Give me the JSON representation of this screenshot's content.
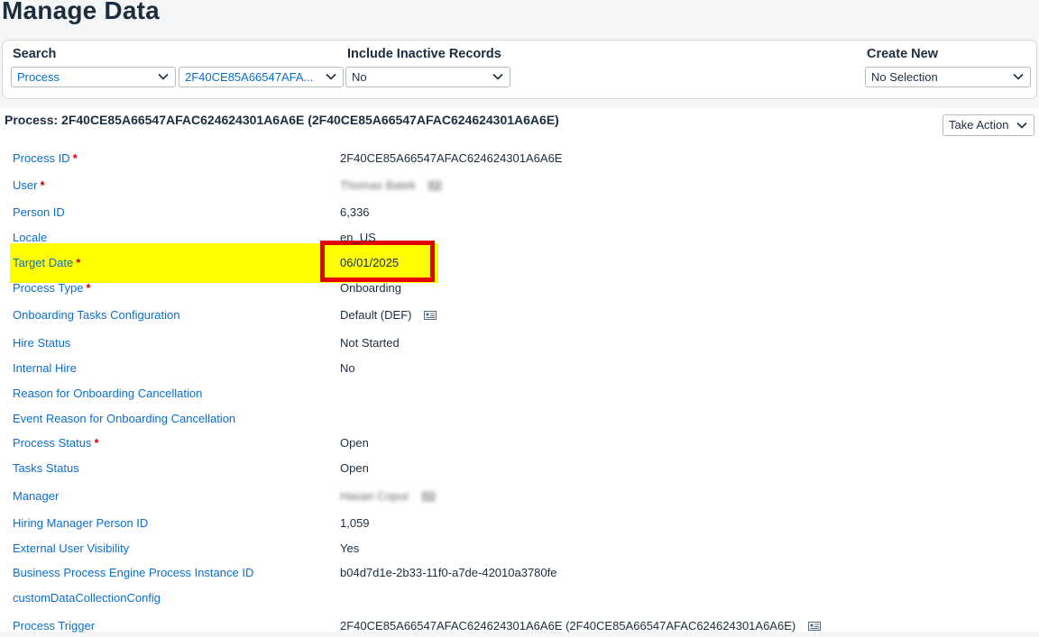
{
  "page": {
    "title": "Manage Data"
  },
  "filter_bar": {
    "search_label": "Search",
    "search_type_value": "Process",
    "search_record_value": "2F40CE85A66547AFA...",
    "inactive_label": "Include Inactive Records",
    "inactive_value": "No",
    "create_label": "Create New",
    "create_value": "No Selection"
  },
  "record": {
    "title": "Process: 2F40CE85A66547AFAC624624301A6A6E (2F40CE85A66547AFAC624624301A6A6E)",
    "take_action_label": "Take Action"
  },
  "fields": [
    {
      "label": "Process ID",
      "required": "*",
      "value": "2F40CE85A66547AFAC624624301A6A6E"
    },
    {
      "label": "User",
      "required": "*",
      "value": "Thomas Batek"
    },
    {
      "label": "Person ID",
      "required": "",
      "value": "6,336"
    },
    {
      "label": "Locale",
      "required": "",
      "value": "en_US"
    },
    {
      "label": "Target Date",
      "required": "*",
      "value": "06/01/2025"
    },
    {
      "label": "Process Type",
      "required": "*",
      "value": "Onboarding"
    },
    {
      "label": "Onboarding Tasks Configuration",
      "required": "",
      "value": "Default (DEF)"
    },
    {
      "label": "Hire Status",
      "required": "",
      "value": "Not Started"
    },
    {
      "label": "Internal Hire",
      "required": "",
      "value": "No"
    },
    {
      "label": "Reason for Onboarding Cancellation",
      "required": "",
      "value": ""
    },
    {
      "label": "Event Reason for Onboarding Cancellation",
      "required": "",
      "value": ""
    },
    {
      "label": "Process Status",
      "required": "*",
      "value": "Open"
    },
    {
      "label": "Tasks Status",
      "required": "",
      "value": "Open"
    },
    {
      "label": "Manager",
      "required": "",
      "value": "Hasan Copur"
    },
    {
      "label": "Hiring Manager Person ID",
      "required": "",
      "value": "1,059"
    },
    {
      "label": "External User Visibility",
      "required": "",
      "value": "Yes"
    },
    {
      "label": "Business Process Engine Process Instance ID",
      "required": "",
      "value": "b04d7d1e-2b33-11f0-a7de-42010a3780fe"
    },
    {
      "label": "customDataCollectionConfig",
      "required": "",
      "value": ""
    },
    {
      "label": "Process Trigger",
      "required": "",
      "value": "2F40CE85A66547AFAC624624301A6A6E (2F40CE85A66547AFAC624624301A6A6E)"
    }
  ],
  "colors": {
    "label_link": "#0a6ed1",
    "required_marker": "#d00000",
    "highlight": "#ffff00",
    "annotation_box": "#e30000"
  },
  "icons": {
    "dropdown": "chevron-down-icon",
    "details": "business-card-icon"
  }
}
